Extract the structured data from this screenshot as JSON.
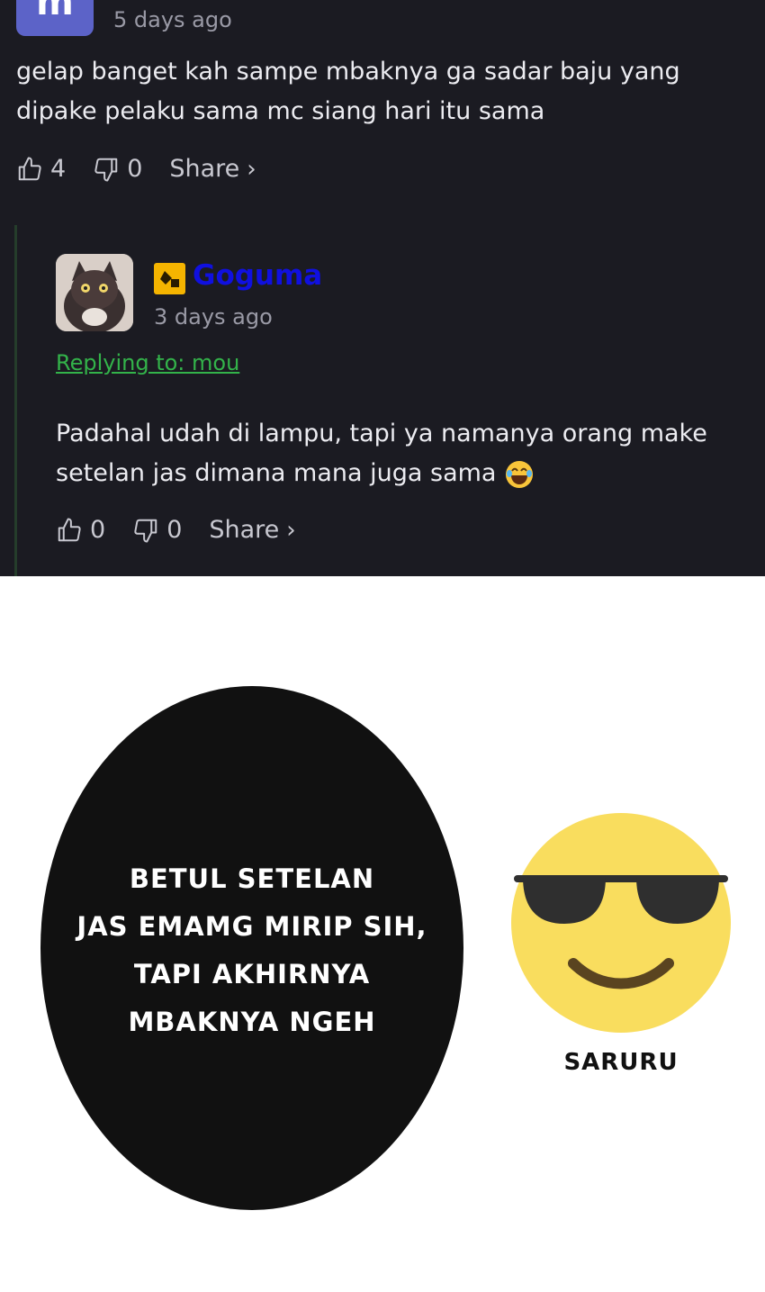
{
  "comment": {
    "avatar_letter": "m",
    "timestamp": "5 days ago",
    "text": "gelap banget kah sampe mbaknya ga sadar baju yang dipake pelaku sama mc siang hari itu sama",
    "upvotes": "4",
    "downvotes": "0",
    "share_label": "Share",
    "share_chevron": "›"
  },
  "reply": {
    "username": "Goguma",
    "timestamp": "3 days ago",
    "replying_to": "Replying to: mou",
    "text": "Padahal udah di lampu, tapi ya namanya orang make setelan jas dimana mana juga sama",
    "upvotes": "0",
    "downvotes": "0",
    "share_label": "Share",
    "share_chevron": "›"
  },
  "panel": {
    "bubble_lines": [
      "BETUL SETELAN",
      "JAS EMAMG MIRIP SIH,",
      "TAPI AKHIRNYA",
      "MBAKNYA NGEH"
    ],
    "credit": "SARURU"
  },
  "colors": {
    "background_dark": "#1b1b22",
    "avatar_m": "#5c63c8",
    "username": "#1010e0",
    "reply_link": "#33b34a",
    "emoji_face": "#f9dd5e"
  },
  "icons": [
    "thumbs-up-icon",
    "thumbs-down-icon",
    "chevron-right-icon",
    "laughing-emoji-icon",
    "sunglasses-smiley-icon"
  ]
}
